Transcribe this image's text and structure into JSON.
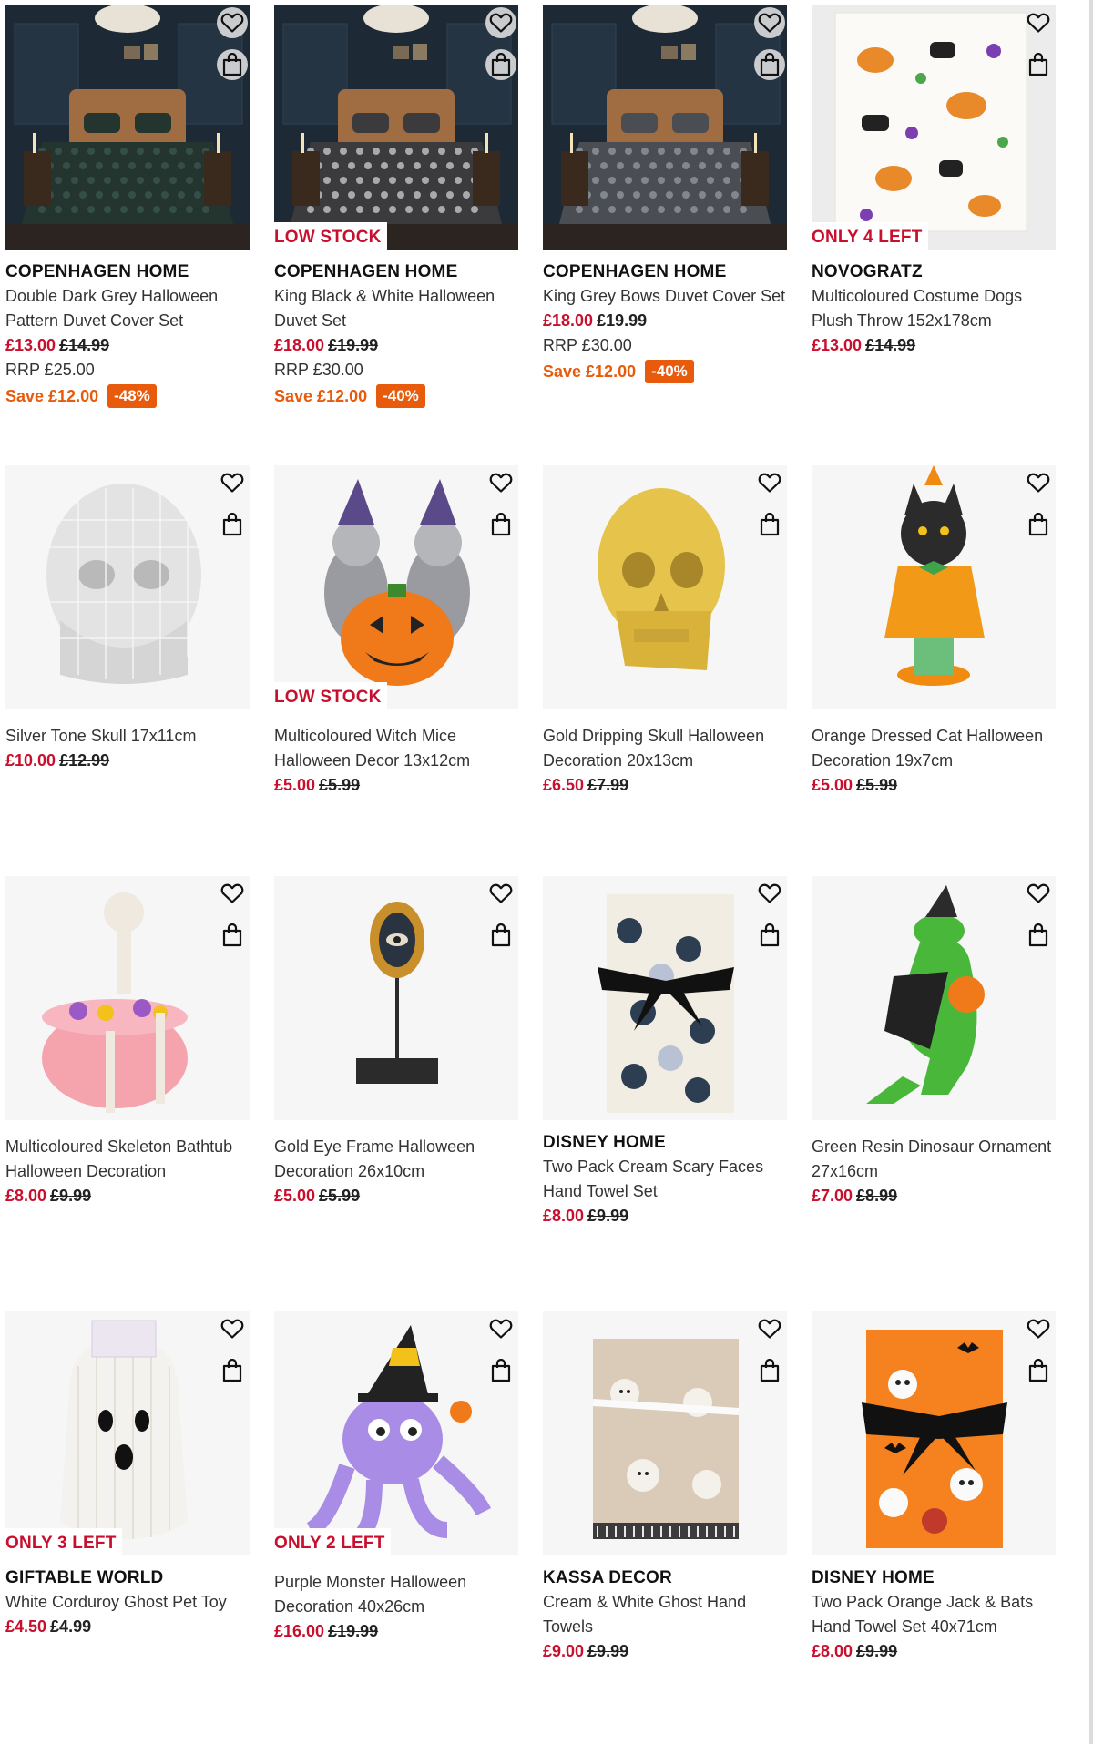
{
  "products": [
    {
      "flag": "",
      "brand": "COPENHAGEN HOME",
      "title": "Double Dark Grey Halloween Pattern Duvet Cover Set",
      "price": "£13.00",
      "was": "£14.99",
      "rrp": "RRP £25.00",
      "save": "Save £12.00",
      "discount": "-48%",
      "image": "dark-grey-duvet"
    },
    {
      "flag": "LOW STOCK",
      "brand": "COPENHAGEN HOME",
      "title": "King Black & White Halloween Duvet Set",
      "price": "£18.00",
      "was": "£19.99",
      "rrp": "RRP £30.00",
      "save": "Save £12.00",
      "discount": "-40%",
      "image": "black-white-duvet"
    },
    {
      "flag": "",
      "brand": "COPENHAGEN HOME",
      "title": "King Grey Bows Duvet Cover Set",
      "price": "£18.00",
      "was": "£19.99",
      "rrp": "RRP £30.00",
      "save": "Save £12.00",
      "discount": "-40%",
      "image": "grey-bows-duvet"
    },
    {
      "flag": "ONLY 4 LEFT",
      "brand": "NOVOGRATZ",
      "title": "Multicoloured Costume Dogs Plush Throw 152x178cm",
      "price": "£13.00",
      "was": "£14.99",
      "rrp": "",
      "save": "",
      "discount": "",
      "image": "dogs-throw"
    },
    {
      "flag": "",
      "brand": "",
      "title": "Silver Tone Skull 17x11cm",
      "price": "£10.00",
      "was": "£12.99",
      "rrp": "",
      "save": "",
      "discount": "",
      "image": "silver-skull"
    },
    {
      "flag": "LOW STOCK",
      "brand": "",
      "title": "Multicoloured Witch Mice Halloween Decor 13x12cm",
      "price": "£5.00",
      "was": "£5.99",
      "rrp": "",
      "save": "",
      "discount": "",
      "image": "witch-mice"
    },
    {
      "flag": "",
      "brand": "",
      "title": "Gold Dripping Skull Halloween Decoration 20x13cm",
      "price": "£6.50",
      "was": "£7.99",
      "rrp": "",
      "save": "",
      "discount": "",
      "image": "gold-skull"
    },
    {
      "flag": "",
      "brand": "",
      "title": "Orange Dressed Cat Halloween Decoration 19x7cm",
      "price": "£5.00",
      "was": "£5.99",
      "rrp": "",
      "save": "",
      "discount": "",
      "image": "orange-cat"
    },
    {
      "flag": "",
      "brand": "",
      "title": "Multicoloured Skeleton Bathtub Halloween Decoration",
      "price": "£8.00",
      "was": "£9.99",
      "rrp": "",
      "save": "",
      "discount": "",
      "image": "skeleton-bathtub"
    },
    {
      "flag": "",
      "brand": "",
      "title": "Gold Eye Frame Halloween Decoration 26x10cm",
      "price": "£5.00",
      "was": "£5.99",
      "rrp": "",
      "save": "",
      "discount": "",
      "image": "eye-frame"
    },
    {
      "flag": "",
      "brand": "DISNEY HOME",
      "title": "Two Pack Cream Scary Faces Hand Towel Set",
      "price": "£8.00",
      "was": "£9.99",
      "rrp": "",
      "save": "",
      "discount": "",
      "image": "cream-towels"
    },
    {
      "flag": "",
      "brand": "",
      "title": "Green Resin Dinosaur Ornament 27x16cm",
      "price": "£7.00",
      "was": "£8.99",
      "rrp": "",
      "save": "",
      "discount": "",
      "image": "green-dinosaur"
    },
    {
      "flag": "ONLY 3 LEFT",
      "brand": "GIFTABLE WORLD",
      "title": "White Corduroy Ghost Pet Toy",
      "price": "£4.50",
      "was": "£4.99",
      "rrp": "",
      "save": "",
      "discount": "",
      "image": "ghost-toy"
    },
    {
      "flag": "ONLY 2 LEFT",
      "brand": "",
      "title": "Purple Monster Halloween Decoration 40x26cm",
      "price": "£16.00",
      "was": "£19.99",
      "rrp": "",
      "save": "",
      "discount": "",
      "image": "purple-monster"
    },
    {
      "flag": "",
      "brand": "KASSA DECOR",
      "title": "Cream & White Ghost Hand Towels",
      "price": "£9.00",
      "was": "£9.99",
      "rrp": "",
      "save": "",
      "discount": "",
      "image": "ghost-towels"
    },
    {
      "flag": "",
      "brand": "DISNEY HOME",
      "title": "Two Pack Orange Jack & Bats Hand Towel Set 40x71cm",
      "price": "£8.00",
      "was": "£9.99",
      "rrp": "",
      "save": "",
      "discount": "",
      "image": "orange-towels"
    }
  ],
  "icons": {
    "wishlist": "heart-icon",
    "bag": "shopping-bag-icon"
  },
  "colors": {
    "price": "#c8102e",
    "save": "#e85a0c",
    "flag": "#c8102e"
  }
}
